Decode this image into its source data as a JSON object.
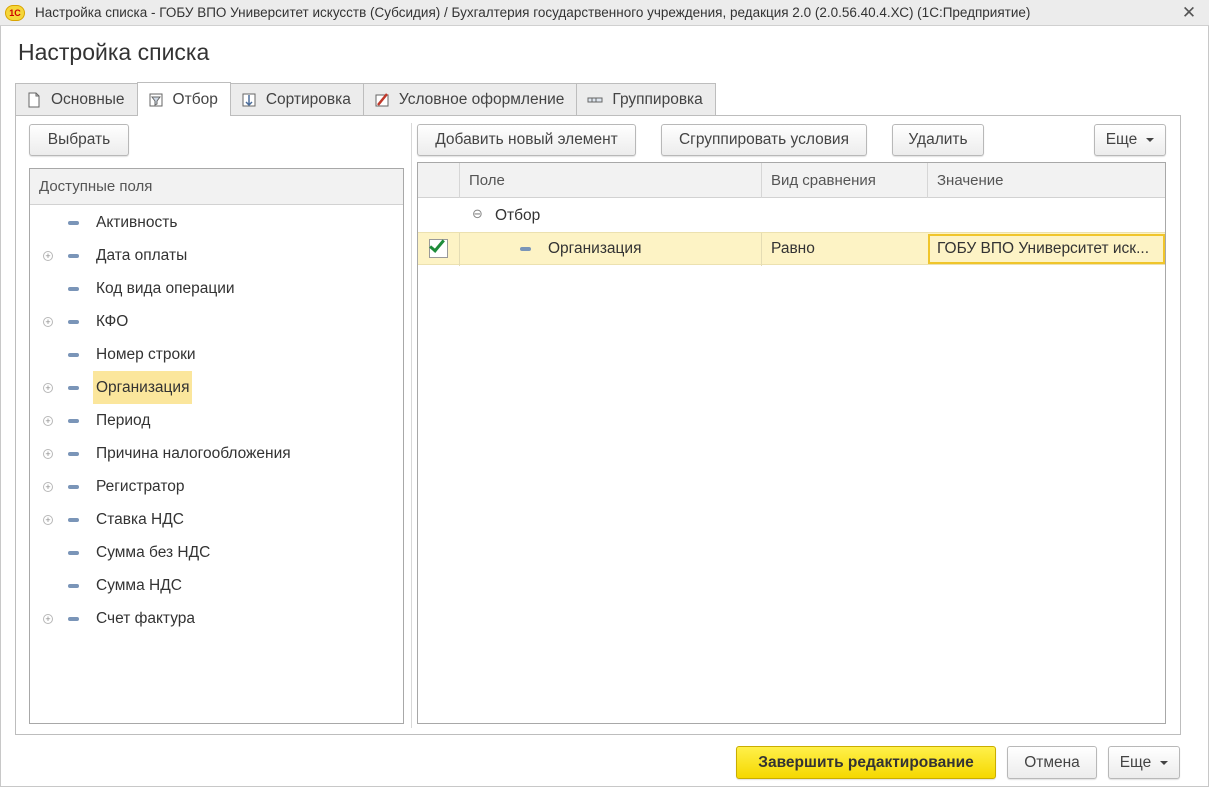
{
  "window": {
    "title": "Настройка списка - ГОБУ ВПО Университет искусств (Субсидия) / Бухгалтерия государственного учреждения, редакция 2.0 (2.0.56.40.4.ХС)  (1С:Предприятие)",
    "logo_text": "1С",
    "close_glyph": "✕"
  },
  "form": {
    "title": "Настройка списка"
  },
  "tabs": [
    {
      "label": "Основные",
      "icon": "page-icon"
    },
    {
      "label": "Отбор",
      "icon": "filter-icon",
      "active": true
    },
    {
      "label": "Сортировка",
      "icon": "sort-icon"
    },
    {
      "label": "Условное оформление",
      "icon": "brush-icon"
    },
    {
      "label": "Группировка",
      "icon": "grouping-icon"
    }
  ],
  "left": {
    "select_button": "Выбрать",
    "header": "Доступные поля",
    "items": [
      {
        "label": "Активность",
        "expandable": false
      },
      {
        "label": "Дата оплаты",
        "expandable": true
      },
      {
        "label": "Код вида операции",
        "expandable": false
      },
      {
        "label": "КФО",
        "expandable": true
      },
      {
        "label": "Номер строки",
        "expandable": false
      },
      {
        "label": "Организация",
        "expandable": true,
        "selected": true
      },
      {
        "label": "Период",
        "expandable": true
      },
      {
        "label": "Причина налогообложения",
        "expandable": true
      },
      {
        "label": "Регистратор",
        "expandable": true
      },
      {
        "label": "Ставка НДС",
        "expandable": true
      },
      {
        "label": "Сумма без НДС",
        "expandable": false
      },
      {
        "label": "Сумма НДС",
        "expandable": false
      },
      {
        "label": "Счет фактура",
        "expandable": true
      }
    ]
  },
  "right": {
    "toolbar": {
      "add": "Добавить новый элемент",
      "group": "Сгруппировать условия",
      "delete": "Удалить",
      "more": "Еще"
    },
    "columns": {
      "field": "Поле",
      "comparison": "Вид сравнения",
      "value": "Значение"
    },
    "group_row": {
      "label": "Отбор",
      "expander": "⊖"
    },
    "rows": [
      {
        "checked": true,
        "field": "Организация",
        "comparison": "Равно",
        "value": "ГОБУ ВПО Университет иск..."
      }
    ]
  },
  "footer": {
    "finish": "Завершить редактирование",
    "cancel": "Отмена",
    "more": "Еще"
  },
  "colors": {
    "accent_yellow": "#f5d800",
    "selection": "#fbe69c",
    "row_highlight": "#fdf3c5"
  }
}
